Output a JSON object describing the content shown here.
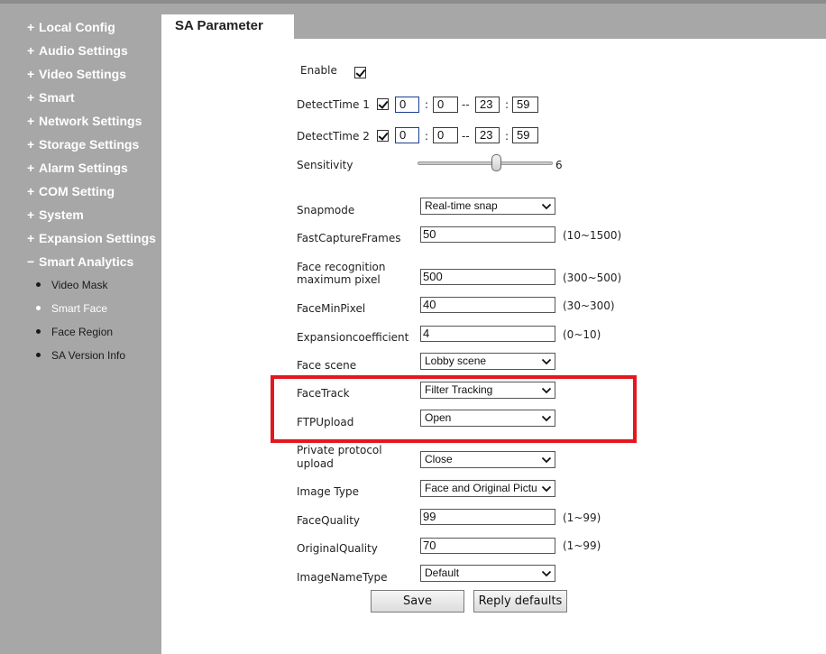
{
  "sidebar": {
    "items": [
      {
        "symbol": "+",
        "label": "Local Config"
      },
      {
        "symbol": "+",
        "label": "Audio Settings"
      },
      {
        "symbol": "+",
        "label": "Video Settings"
      },
      {
        "symbol": "+",
        "label": "Smart"
      },
      {
        "symbol": "+",
        "label": "Network Settings"
      },
      {
        "symbol": "+",
        "label": "Storage Settings"
      },
      {
        "symbol": "+",
        "label": "Alarm Settings"
      },
      {
        "symbol": "+",
        "label": "COM Setting"
      },
      {
        "symbol": "+",
        "label": "System"
      },
      {
        "symbol": "+",
        "label": "Expansion Settings"
      },
      {
        "symbol": "−",
        "label": "Smart Analytics"
      }
    ],
    "sub_items": [
      {
        "label": "Video Mask",
        "active": false
      },
      {
        "label": "Smart Face",
        "active": true
      },
      {
        "label": "Face Region",
        "active": false
      },
      {
        "label": "SA Version Info",
        "active": false
      }
    ]
  },
  "tab": {
    "label": "SA Parameter"
  },
  "form": {
    "enable": {
      "label": "Enable",
      "checked": true
    },
    "detect_time_1": {
      "label": "DetectTime 1",
      "checked": true,
      "start_h": "0",
      "start_m": "0",
      "end_h": "23",
      "end_m": "59"
    },
    "detect_time_2": {
      "label": "DetectTime 2",
      "checked": true,
      "start_h": "0",
      "start_m": "0",
      "end_h": "23",
      "end_m": "59"
    },
    "time_sep": ":",
    "range_sep": "--",
    "sensitivity": {
      "label": "Sensitivity",
      "value": "6",
      "level": 6
    },
    "snapmode": {
      "label": "Snapmode",
      "value": "Real-time snap"
    },
    "fast_capture_frames": {
      "label": "FastCaptureFrames",
      "value": "50",
      "hint": "(10~1500)"
    },
    "face_recognition_max": {
      "label_line1": "Face recognition",
      "label_line2": "maximum pixel",
      "value": "500",
      "hint": "(300~500)"
    },
    "face_min_pixel": {
      "label": "FaceMinPixel",
      "value": "40",
      "hint": "(30~300)"
    },
    "expansion_coefficient": {
      "label": "Expansioncoefficient",
      "value": "4",
      "hint": "(0~10)"
    },
    "face_scene": {
      "label": "Face scene",
      "value": "Lobby scene"
    },
    "face_track": {
      "label": "FaceTrack",
      "value": "Filter Tracking"
    },
    "ftp_upload": {
      "label": "FTPUpload",
      "value": "Open"
    },
    "private_protocol_upload": {
      "label_line1": "Private protocol",
      "label_line2": "upload",
      "value": "Close"
    },
    "image_type": {
      "label": "Image Type",
      "value": "Face and Original Pictu"
    },
    "face_quality": {
      "label": "FaceQuality",
      "value": "99",
      "hint": "(1~99)"
    },
    "original_quality": {
      "label": "OriginalQuality",
      "value": "70",
      "hint": "(1~99)"
    },
    "image_name_type": {
      "label": "ImageNameType",
      "value": "Default"
    }
  },
  "buttons": {
    "save": "Save",
    "reply_defaults": "Reply defaults"
  },
  "colors": {
    "sidebar_bg": "#a7a7a7",
    "highlight_box": "#e3171f",
    "content_bg": "#ffffff"
  }
}
